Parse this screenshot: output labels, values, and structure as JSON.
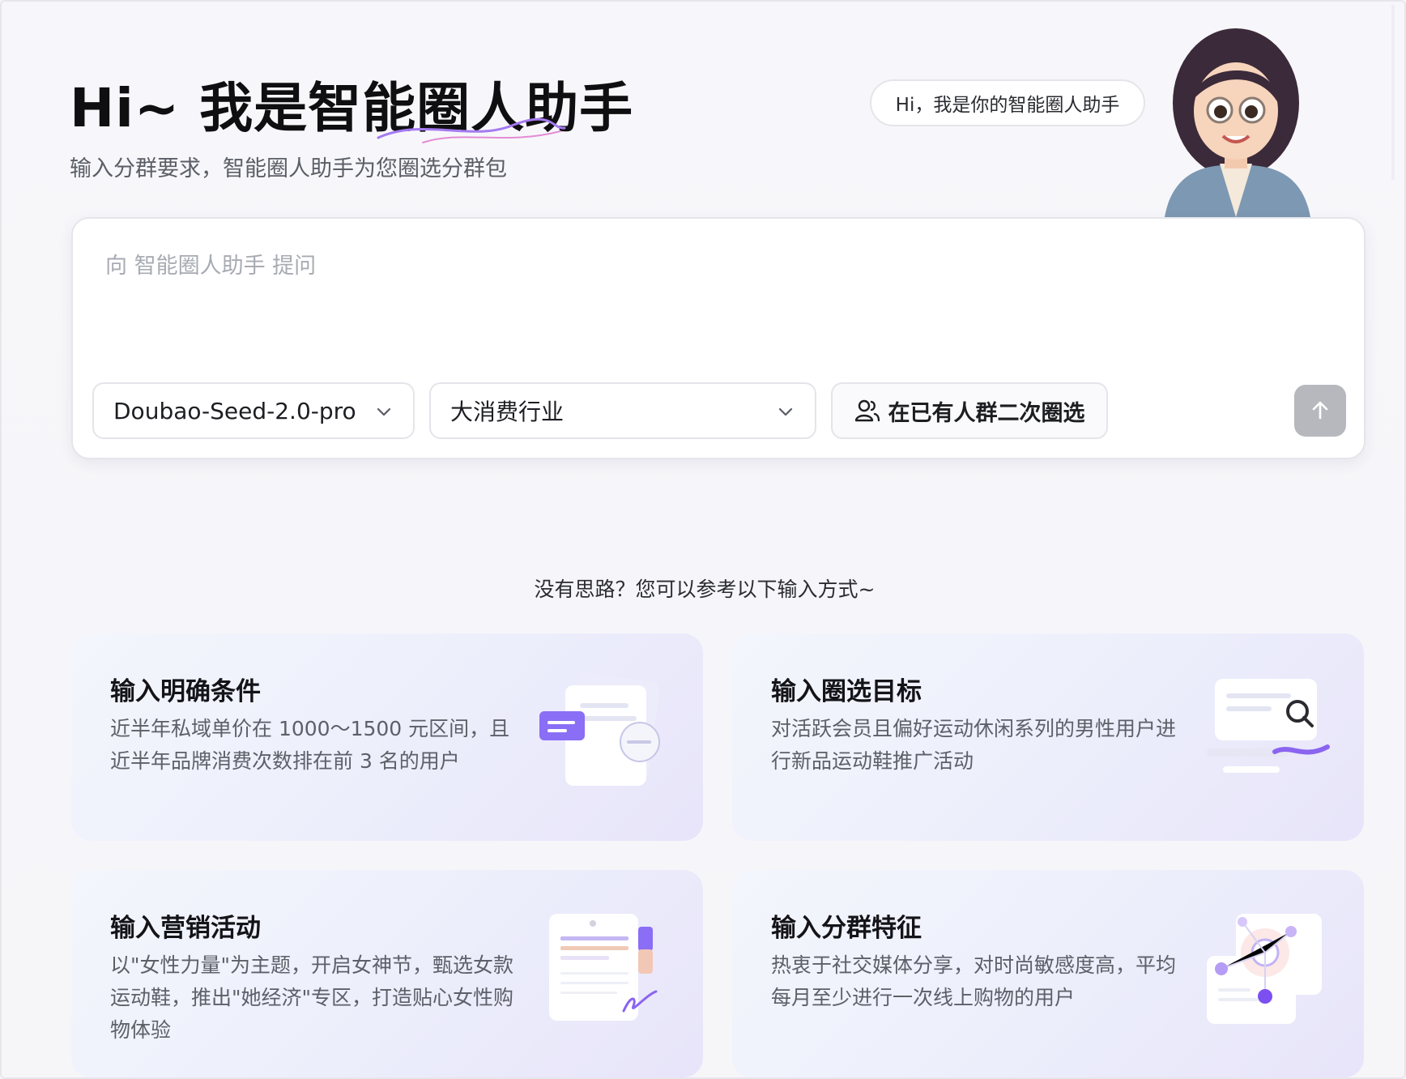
{
  "header": {
    "title": "Hi~ 我是智能圈人助手",
    "subtitle": "输入分群要求，智能圈人助手为您圈选分群包",
    "greeting": "Hi，我是你的智能圈人助手"
  },
  "prompt": {
    "placeholder": "向 智能圈人助手 提问",
    "model_select": "Doubao-Seed-2.0-pro",
    "industry_select": "大消费行业",
    "reselect_button": "在已有人群二次圈选"
  },
  "suggestions": {
    "hint": "没有思路？您可以参考以下输入方式~",
    "cards": [
      {
        "title": "输入明确条件",
        "desc": "近半年私域单价在 1000～1500 元区间，且近半年品牌消费次数排在前 3 名的用户",
        "icon": "document-tag-icon"
      },
      {
        "title": "输入圈选目标",
        "desc": "对活跃会员且偏好运动休闲系列的男性用户进行新品运动鞋推广活动",
        "icon": "search-card-icon"
      },
      {
        "title": "输入营销活动",
        "desc": "以\"女性力量\"为主题，开启女神节，甄选女款运动鞋，推出\"她经济\"专区，打造贴心女性购物体验",
        "icon": "clipboard-icon"
      },
      {
        "title": "输入分群特征",
        "desc": "热衷于社交媒体分享，对时尚敏感度高，平均每月至少进行一次线上购物的用户",
        "icon": "network-nodes-icon"
      }
    ]
  },
  "colors": {
    "accent_purple": "#7b5cf5",
    "send_disabled": "#b7b8bd"
  }
}
